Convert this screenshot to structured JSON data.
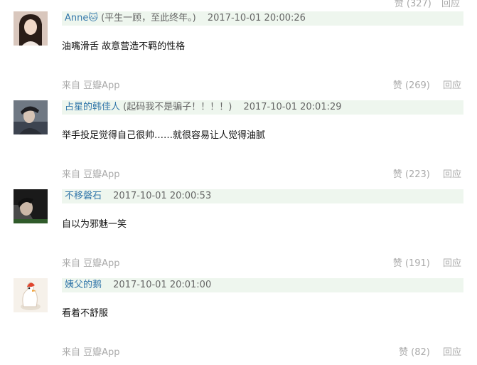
{
  "top_actions": {
    "like": "赞 (327)",
    "reply": "回应"
  },
  "comments": [
    {
      "author": "Anne🐱",
      "signature": "(平生一顾，至此终年。)",
      "timestamp": "2017-10-01 20:00:26",
      "content": "油嘴滑舌 故意营造不羁的性格",
      "source": "来自 豆瓣App",
      "like_label": "赞 (269)",
      "reply_label": "回应",
      "avatar_icon": "woman-long-hair-avatar-icon"
    },
    {
      "author": "占星的韩佳人",
      "signature": "(起码我不是骗子！！！！)",
      "timestamp": "2017-10-01 20:01:29",
      "content": "举手投足觉得自己很帅……就很容易让人觉得油腻",
      "source": "来自 豆瓣App",
      "like_label": "赞 (223)",
      "reply_label": "回应",
      "avatar_icon": "person-hat-avatar-icon"
    },
    {
      "author": "不移磐石",
      "signature": "",
      "timestamp": "2017-10-01 20:00:53",
      "content": "自以为邪魅一笑",
      "source": "来自 豆瓣App",
      "like_label": "赞 (191)",
      "reply_label": "回应",
      "avatar_icon": "dark-portrait-avatar-icon"
    },
    {
      "author": "姨父的鹅",
      "signature": "",
      "timestamp": "2017-10-01 20:01:00",
      "content": "看着不舒服",
      "source": "来自 豆瓣App",
      "like_label": "赞 (82)",
      "reply_label": "回应",
      "avatar_icon": "cartoon-goose-avatar-icon"
    }
  ],
  "colors": {
    "meta_bar_bg": "#eef6ee",
    "author_link": "#3377aa",
    "muted_text": "#aaaaaa",
    "secondary_text": "#666666"
  }
}
